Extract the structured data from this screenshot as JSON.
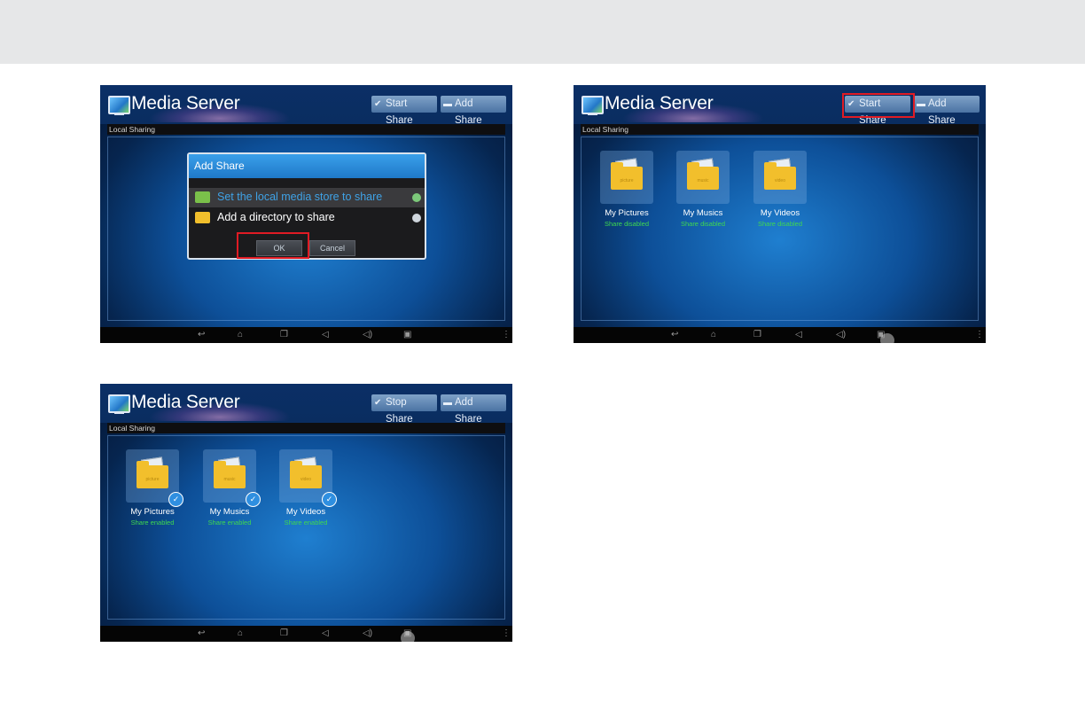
{
  "app": {
    "title": "Media Server",
    "section_label": "Local Sharing",
    "add_share_label": "Add Share",
    "start_share_label": "Start Share",
    "stop_share_label": "Stop Share"
  },
  "dialog": {
    "title": "Add Share",
    "options": [
      {
        "label": "Set the local media store to share",
        "selected": true
      },
      {
        "label": "Add a directory to share",
        "selected": false
      }
    ],
    "ok_label": "OK",
    "cancel_label": "Cancel"
  },
  "folders_disabled": [
    {
      "name": "My Pictures",
      "status": "Share disabled",
      "tag": "picture"
    },
    {
      "name": "My Musics",
      "status": "Share disabled",
      "tag": "music"
    },
    {
      "name": "My Videos",
      "status": "Share disabled",
      "tag": "video"
    }
  ],
  "folders_enabled": [
    {
      "name": "My Pictures",
      "status": "Share enabled",
      "tag": "picture"
    },
    {
      "name": "My Musics",
      "status": "Share enabled",
      "tag": "music"
    },
    {
      "name": "My Videos",
      "status": "Share enabled",
      "tag": "video"
    }
  ],
  "icons": {
    "app": "monitor-icon",
    "share": "share-check-icon",
    "folder": "folder-icon",
    "nav": [
      "back-icon",
      "home-icon",
      "recent-apps-icon",
      "volume-down-icon",
      "volume-up-icon",
      "screenshot-icon",
      "menu-icon"
    ]
  },
  "colors": {
    "highlight": "#e01b24",
    "status_green": "#3fd94f",
    "dialog_header": "#2a8ad8",
    "selected_option_text": "#3fa2e6"
  }
}
